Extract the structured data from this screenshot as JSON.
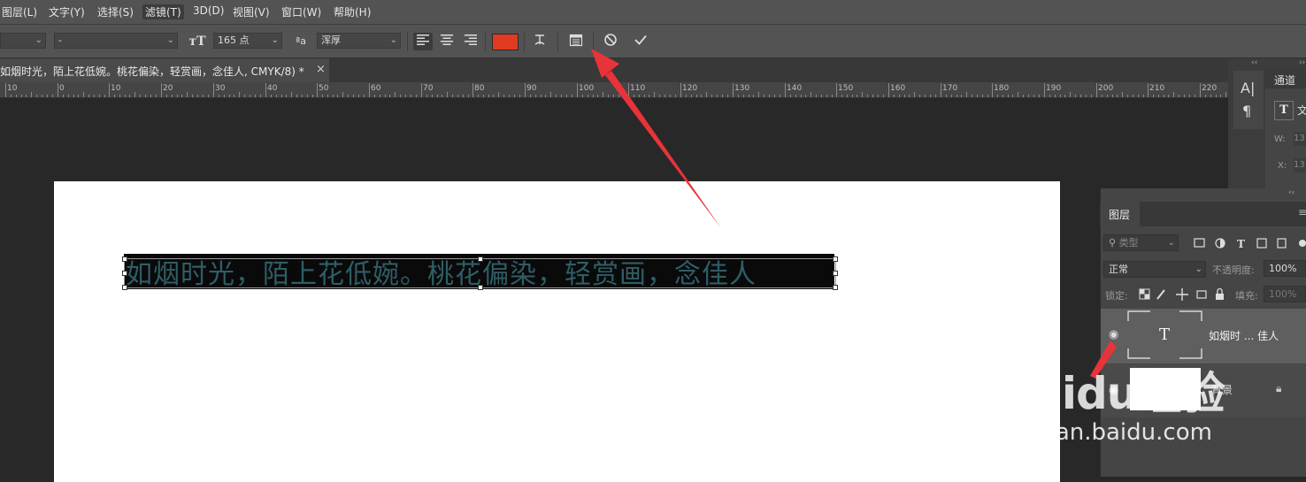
{
  "menu": [
    "图层(L)",
    "文字(Y)",
    "选择(S)",
    "滤镜(T)",
    "3D(D)",
    "视图(V)",
    "窗口(W)",
    "帮助(H)"
  ],
  "options": {
    "font_style": "-",
    "font_size": "165 点",
    "aa_icon_label": "a",
    "anti_alias": "浑厚",
    "text_color": "#e03a22"
  },
  "document_tab": {
    "title": "如烟时光，陌上花低婉。桃花偏染，轻赏画，念佳人, CMYK/8) *",
    "close": "×"
  },
  "ruler_labels": [
    "10",
    "0",
    "10",
    "20",
    "30",
    "40",
    "50",
    "60",
    "70",
    "80",
    "90",
    "100",
    "110",
    "120",
    "130",
    "140",
    "150",
    "160",
    "170",
    "180",
    "190",
    "200",
    "210",
    "220"
  ],
  "canvas_text": "如烟时光，陌上花低婉。桃花偏染，轻赏画，念佳人",
  "panels": {
    "channels_tab": "通道",
    "char_icon": "A|",
    "para_icon": "¶",
    "props_type_icon": "T",
    "props_type_label": "文",
    "w_label": "W:",
    "w_value": "13",
    "x_label": "X:",
    "x_value": "13"
  },
  "layers": {
    "tab": "图层",
    "filter_label": "类型",
    "blend_mode": "正常",
    "opacity_label": "不透明度:",
    "opacity_value": "100%",
    "lock_label": "锁定:",
    "fill_label": "填充:",
    "fill_value": "100%",
    "items": [
      {
        "name": "如烟时 ... 佳人",
        "thumb": "T"
      },
      {
        "name": "背景"
      }
    ]
  },
  "watermark": {
    "main": "Baidu经验",
    "sub": "jingyan.baidu.com"
  },
  "colors": {
    "annotation_arrow": "#e8333a",
    "text_fill": "#2f5d66",
    "accent_swatch": "#e03a22"
  }
}
